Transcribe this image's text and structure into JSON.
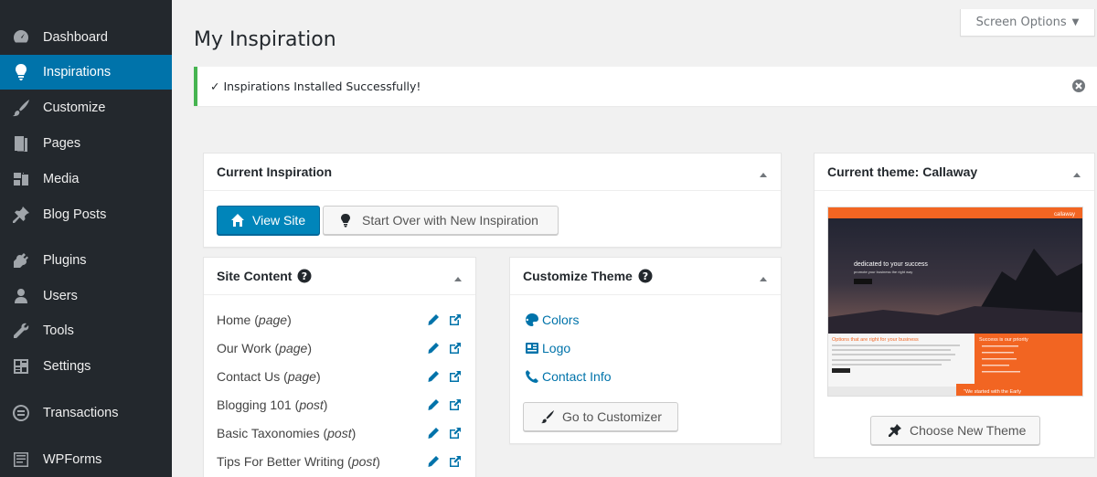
{
  "sidebar": {
    "items": [
      {
        "label": "Dashboard",
        "icon": "dashboard-icon",
        "active": false
      },
      {
        "label": "Inspirations",
        "icon": "lightbulb-icon",
        "active": true
      },
      {
        "label": "Customize",
        "icon": "paintbrush-icon",
        "active": false
      },
      {
        "label": "Pages",
        "icon": "pages-icon",
        "active": false
      },
      {
        "label": "Media",
        "icon": "media-icon",
        "active": false
      },
      {
        "label": "Blog Posts",
        "icon": "pushpin-icon",
        "active": false
      },
      {
        "label": "Plugins",
        "icon": "plugins-icon",
        "active": false
      },
      {
        "label": "Users",
        "icon": "users-icon",
        "active": false
      },
      {
        "label": "Tools",
        "icon": "wrench-icon",
        "active": false
      },
      {
        "label": "Settings",
        "icon": "settings-icon",
        "active": false
      },
      {
        "label": "Transactions",
        "icon": "transactions-icon",
        "active": false
      },
      {
        "label": "WPForms",
        "icon": "wpforms-icon",
        "active": false
      }
    ]
  },
  "screen_options": {
    "label": "Screen Options"
  },
  "page": {
    "title": "My Inspiration"
  },
  "notice": {
    "text": "✓ Inspirations Installed Successfully!"
  },
  "current_inspiration": {
    "title": "Current Inspiration",
    "view_site_label": "View Site",
    "start_over_label": "Start Over with New Inspiration"
  },
  "site_content": {
    "title": "Site Content",
    "rows": [
      {
        "name": "Home",
        "type": "page"
      },
      {
        "name": "Our Work",
        "type": "page"
      },
      {
        "name": "Contact Us",
        "type": "page"
      },
      {
        "name": "Blogging 101",
        "type": "post"
      },
      {
        "name": "Basic Taxonomies",
        "type": "post"
      },
      {
        "name": "Tips For Better Writing",
        "type": "post"
      }
    ]
  },
  "customize_theme": {
    "title": "Customize Theme",
    "links": [
      {
        "label": "Colors",
        "icon": "palette-icon"
      },
      {
        "label": "Logo",
        "icon": "logo-icon"
      },
      {
        "label": "Contact Info",
        "icon": "phone-icon"
      }
    ],
    "go_label": "Go to Customizer"
  },
  "current_theme": {
    "title": "Current theme: Callaway",
    "choose_label": "Choose New Theme",
    "preview": {
      "brand": "callaway",
      "hero_heading": "dedicated to your success",
      "hero_sub": "promote your business the right way",
      "left_heading": "Options that are right for your business",
      "right_heading": "Success is our priority",
      "banner": "\"We started with the Early"
    }
  },
  "colors": {
    "sidebar_bg": "#23282d",
    "active": "#0073aa",
    "success": "#46b450",
    "link": "#0073aa",
    "theme_orange": "#f26522"
  }
}
